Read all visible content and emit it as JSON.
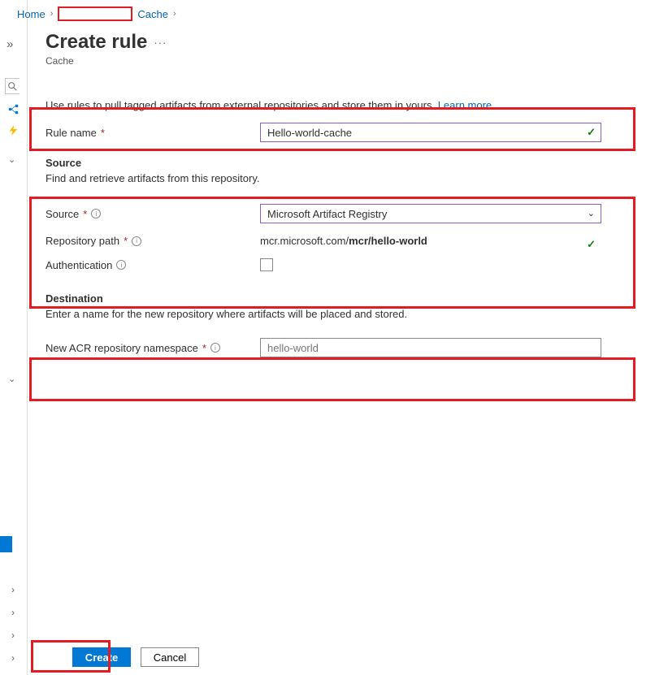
{
  "breadcrumb": {
    "home": "Home",
    "current": "Cache"
  },
  "header": {
    "title": "Create rule",
    "subtitle": "Cache"
  },
  "intro": {
    "text": "Use rules to pull tagged artifacts from external repositories and store them in yours.",
    "learn_more": "Learn more"
  },
  "form": {
    "rule_name_label": "Rule name",
    "rule_name_value": "Hello-world-cache",
    "source_heading": "Source",
    "source_desc": "Find and retrieve artifacts from this repository.",
    "source_label": "Source",
    "source_value": "Microsoft Artifact Registry",
    "repo_label": "Repository path",
    "repo_prefix": "mcr.microsoft.com/",
    "repo_bold": "mcr/hello-world",
    "auth_label": "Authentication",
    "dest_heading": "Destination",
    "dest_desc": "Enter a name for the new repository where artifacts will be placed and stored.",
    "dest_label": "New ACR repository namespace",
    "dest_value": "hello-world"
  },
  "footer": {
    "create": "Create",
    "cancel": "Cancel"
  }
}
